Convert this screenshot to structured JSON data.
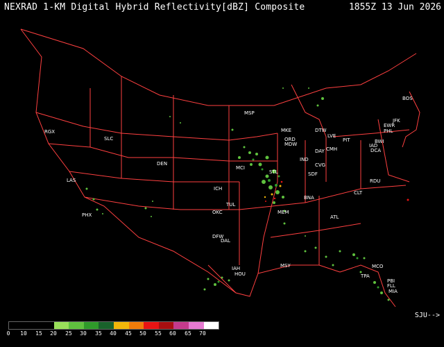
{
  "header": {
    "title": "NEXRAD 1-KM Digital Hybrid Reflectivity[dBZ] Composite",
    "timestamp": "1855Z 13 Jun 2026"
  },
  "map": {
    "border_color": "#ff4040",
    "stations": [
      {
        "code": "RGX"
      },
      {
        "code": "SLC"
      },
      {
        "code": "DEN"
      },
      {
        "code": "LAS"
      },
      {
        "code": "PHX"
      },
      {
        "code": "MSP"
      },
      {
        "code": "MKE"
      },
      {
        "code": "ORD"
      },
      {
        "code": "MDW"
      },
      {
        "code": "DTW"
      },
      {
        "code": "LVE"
      },
      {
        "code": "PIT"
      },
      {
        "code": "BOS"
      },
      {
        "code": "JFK"
      },
      {
        "code": "EWR"
      },
      {
        "code": "PHL"
      },
      {
        "code": "BWI"
      },
      {
        "code": "IAD"
      },
      {
        "code": "DCA"
      },
      {
        "code": "DAY"
      },
      {
        "code": "CMH"
      },
      {
        "code": "CVG"
      },
      {
        "code": "IND"
      },
      {
        "code": "SDF"
      },
      {
        "code": "STL"
      },
      {
        "code": "MCI"
      },
      {
        "code": "ICH"
      },
      {
        "code": "TUL"
      },
      {
        "code": "OKC"
      },
      {
        "code": "DFW"
      },
      {
        "code": "DAL"
      },
      {
        "code": "IAH"
      },
      {
        "code": "HOU"
      },
      {
        "code": "MSY"
      },
      {
        "code": "MEM"
      },
      {
        "code": "BNA"
      },
      {
        "code": "ATL"
      },
      {
        "code": "CLT"
      },
      {
        "code": "RDU"
      },
      {
        "code": "MCO"
      },
      {
        "code": "TPA"
      },
      {
        "code": "PBI"
      },
      {
        "code": "FLL"
      },
      {
        "code": "MIA"
      }
    ]
  },
  "legend": {
    "credit": "SJU-->",
    "scale": [
      {
        "label": "0",
        "color": "#000000"
      },
      {
        "label": "10",
        "color": "#000000"
      },
      {
        "label": "15",
        "color": "#000000"
      },
      {
        "label": "20",
        "color": "#9ae05a"
      },
      {
        "label": "25",
        "color": "#5fc13e"
      },
      {
        "label": "30",
        "color": "#2f9a2a"
      },
      {
        "label": "35",
        "color": "#19622b"
      },
      {
        "label": "40",
        "color": "#f2b60a"
      },
      {
        "label": "45",
        "color": "#f07c0a"
      },
      {
        "label": "50",
        "color": "#e81414"
      },
      {
        "label": "55",
        "color": "#a80f10"
      },
      {
        "label": "60",
        "color": "#c43a8c"
      },
      {
        "label": "65",
        "color": "#e57ad0"
      },
      {
        "label": "70",
        "color": "#ffffff"
      }
    ]
  }
}
